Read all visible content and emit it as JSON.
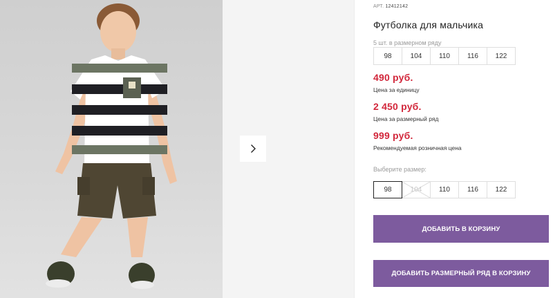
{
  "product": {
    "art_label": "АРТ.",
    "art_number": "12412142",
    "title": "Футболка для мальчика",
    "pack_note": "5 шт. в размерном ряду",
    "pack_sizes": [
      "98",
      "104",
      "110",
      "116",
      "122"
    ],
    "unit_price": "490 руб.",
    "unit_price_label": "Цена за единицу",
    "pack_price": "2 450 руб.",
    "pack_price_label": "Цена за размерный ряд",
    "retail_price": "999 руб.",
    "retail_price_label": "Рекомендуемая розничная цена"
  },
  "size_picker": {
    "label": "Выберите размер:",
    "sizes": [
      {
        "label": "98",
        "state": "selected"
      },
      {
        "label": "104",
        "state": "disabled"
      },
      {
        "label": "110",
        "state": "available"
      },
      {
        "label": "116",
        "state": "available"
      },
      {
        "label": "122",
        "state": "available"
      }
    ]
  },
  "actions": {
    "add_to_cart": "ДОБАВИТЬ В КОРЗИНУ",
    "add_pack_to_cart": "ДОБАВИТЬ РАЗМЕРНЫЙ РЯД В КОРЗИНУ"
  },
  "colors": {
    "accent": "#7d5b9e",
    "price": "#d2283c"
  },
  "icons": {
    "next": "chevron-right-icon"
  }
}
